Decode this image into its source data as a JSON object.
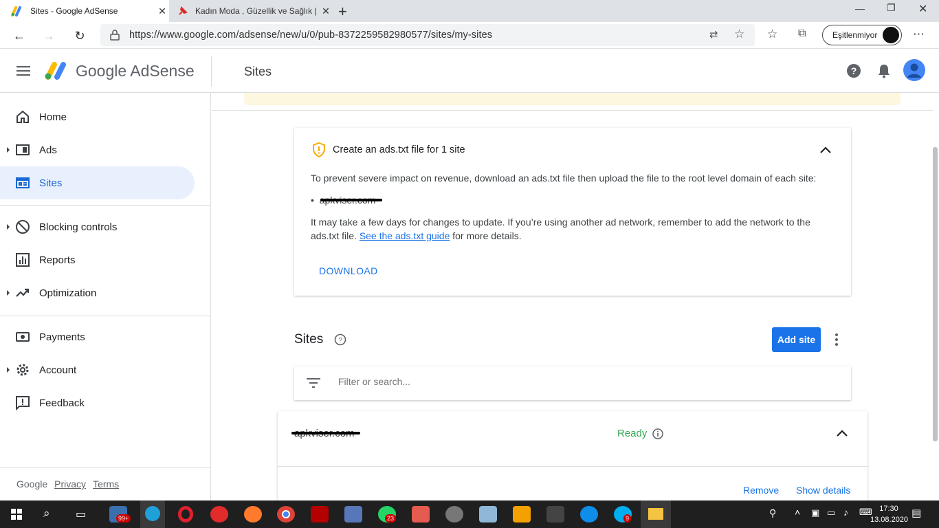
{
  "browser": {
    "tabs": [
      {
        "title": "Sites - Google AdSense",
        "active": true
      },
      {
        "title": "Kadın Moda , Güzellik ve Sağlık |",
        "active": false
      }
    ],
    "url": "https://www.google.com/adsense/new/u/0/pub-8372259582980577/sites/my-sites",
    "sync_label": "Eşitlenmiyor"
  },
  "header": {
    "brand": "Google AdSense",
    "page_title": "Sites"
  },
  "sidebar": {
    "items": [
      {
        "label": "Home",
        "icon": "home-icon"
      },
      {
        "label": "Ads",
        "icon": "ads-icon"
      },
      {
        "label": "Sites",
        "icon": "sites-icon",
        "selected": true
      },
      {
        "label": "Blocking controls",
        "icon": "block-icon"
      },
      {
        "label": "Reports",
        "icon": "reports-icon"
      },
      {
        "label": "Optimization",
        "icon": "trending-icon"
      },
      {
        "label": "Payments",
        "icon": "payments-icon"
      },
      {
        "label": "Account",
        "icon": "gear-icon"
      },
      {
        "label": "Feedback",
        "icon": "feedback-icon"
      }
    ],
    "footer": {
      "google": "Google",
      "privacy": "Privacy",
      "terms": "Terms"
    }
  },
  "adstxt_card": {
    "title": "Create an ads.txt file for 1 site",
    "description": "To prevent severe impact on revenue, download an ads.txt file then upload the file to the root level domain of each site:",
    "site": "apkviser.com",
    "note_part1": "It may take a few days for changes to update. If you’re using another ad network, remember to add the network to the ads.txt file.",
    "note_link": "See the ads.txt guide",
    "note_part2": "for more details.",
    "download": "DOWNLOAD"
  },
  "sites_section": {
    "heading": "Sites",
    "add_site": "Add site",
    "filter_placeholder": "Filter or search...",
    "site_row": {
      "domain": "apkviser.com",
      "status": "Ready",
      "remove": "Remove",
      "show_details": "Show details"
    }
  },
  "taskbar": {
    "time": "17:30",
    "date": "13.08.2020",
    "mail_badge": "99+",
    "whatsapp_badge": "23",
    "skype_badge": "9"
  },
  "colors": {
    "accent": "#1a73e8",
    "ready": "#34a853",
    "banner": "#fef7e0",
    "selected_nav": "#e8f0fe"
  }
}
